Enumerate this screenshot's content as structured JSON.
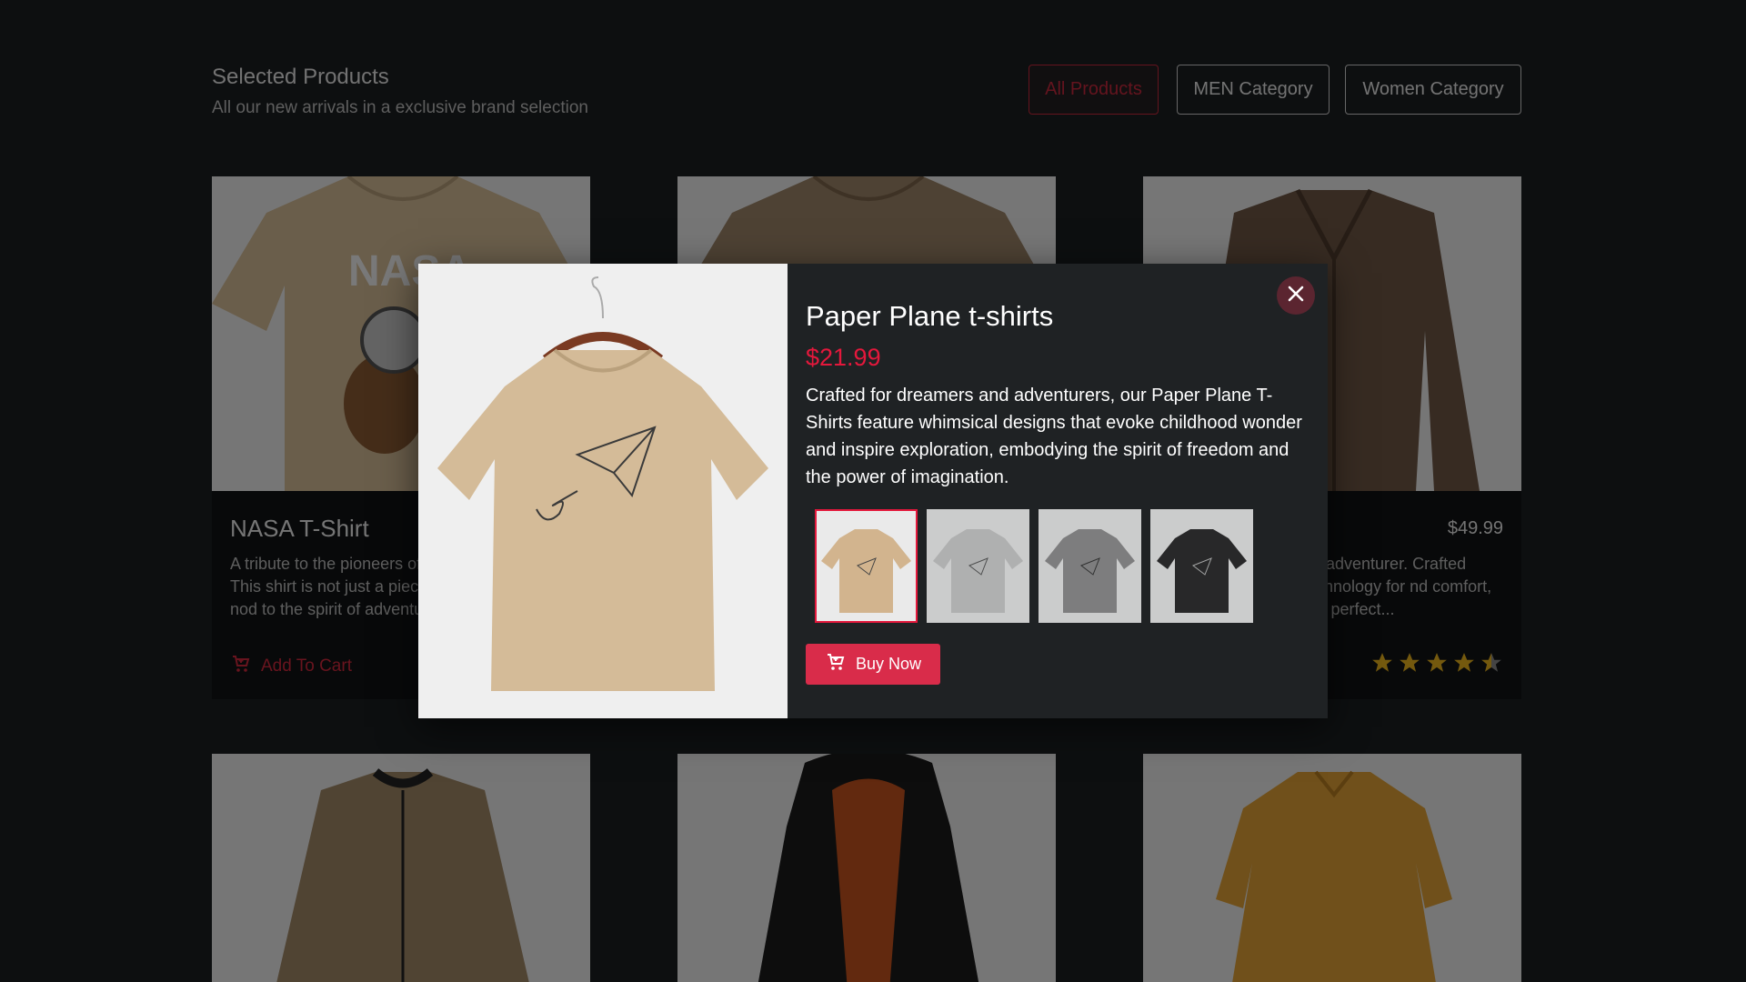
{
  "header": {
    "title": "Selected Products",
    "subtitle": "All our new arrivals in a exclusive brand selection"
  },
  "filters": [
    {
      "label": "All Products",
      "active": true
    },
    {
      "label": "MEN Category",
      "active": false
    },
    {
      "label": "Women Category",
      "active": false
    }
  ],
  "cards": [
    {
      "name": "NASA T-Shirt",
      "price": "",
      "description": "A tribute to the pioneers of space exploration. This shirt is not just a piece of clothing; it's a nod to the spirit of adventure.",
      "cart_label": "Add To Cart",
      "image": "tan tshirt with NASA print and teddy bear astronaut"
    },
    {
      "name": "",
      "price": "",
      "description": "",
      "cart_label": "",
      "image": "brown tshirt"
    },
    {
      "name": "",
      "price": "$49.99",
      "description": "rn adventurer. Crafted echnology for nd comfort, it's perfect...",
      "rating": 4.5,
      "image": "brown military jacket"
    },
    {
      "image": "khaki bomber jacket"
    },
    {
      "image": "black puffer jacket with orange lining"
    },
    {
      "image": "mustard long dress"
    }
  ],
  "modal": {
    "title": "Paper Plane t-shirts",
    "price": "$21.99",
    "description": "Crafted for dreamers and adventurers, our Paper Plane T-Shirts feature whimsical designs that evoke childhood wonder and inspire exploration, embodying the spirit of freedom and the power of imagination.",
    "variants": [
      {
        "color": "#d2b48e",
        "selected": true
      },
      {
        "color": "#c9c9c9",
        "selected": false
      },
      {
        "color": "#8e8e8e",
        "selected": false
      },
      {
        "color": "#2a2a2a",
        "selected": false
      }
    ],
    "buy_label": "Buy Now",
    "close_icon": "close-icon"
  },
  "colors": {
    "accent": "#e4183c",
    "background": "#1b1e20",
    "modal_bg": "#1f2224"
  }
}
